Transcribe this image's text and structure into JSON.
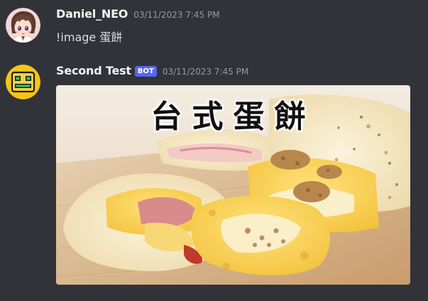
{
  "messages": [
    {
      "author": "Daniel_NEO",
      "timestamp": "03/11/2023 7:45 PM",
      "text": "!image 蛋餅",
      "avatar_icon": "anime-boy-avatar-icon"
    },
    {
      "author": "Second Test",
      "tag": "BOT",
      "timestamp": "03/11/2023 7:45 PM",
      "avatar_icon": "robot-face-avatar-icon",
      "attachment": {
        "caption": "台式蛋餅"
      }
    }
  ],
  "colors": {
    "background": "#313338",
    "username": "#f2f3f5",
    "timestamp": "#949ba4",
    "message_text": "#dbdee1",
    "bot_tag": "#5865f2"
  }
}
